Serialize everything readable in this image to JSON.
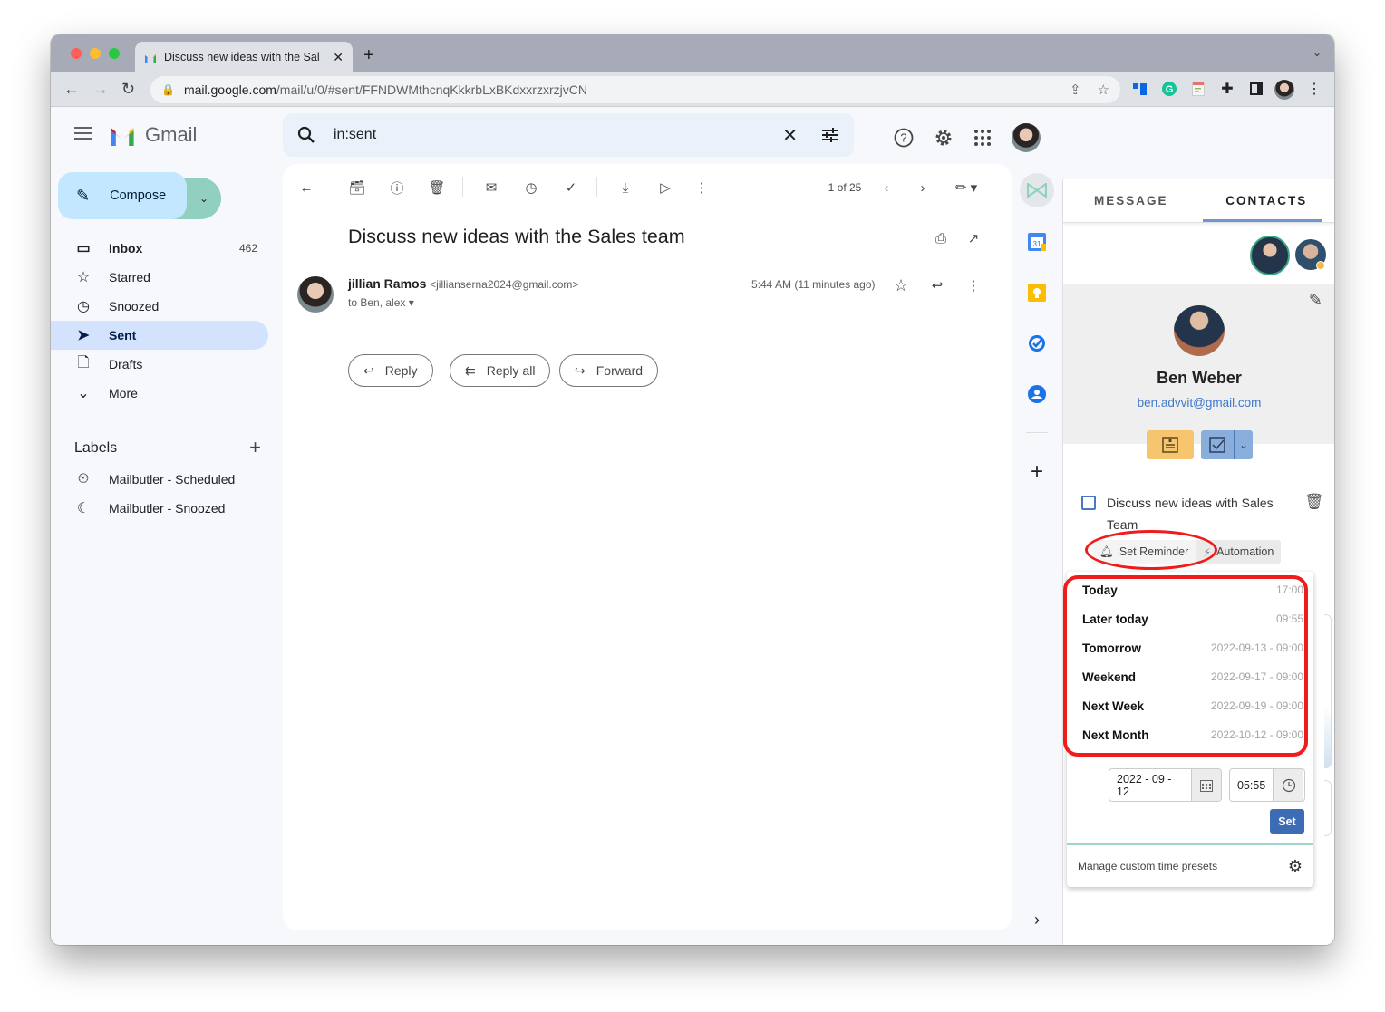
{
  "browser": {
    "tab_title": "Discuss new ideas with the Sal",
    "url_host": "mail.google.com",
    "url_path": "/mail/u/0/#sent/FFNDWMthcnqKkkrbLxBKdxxrzxrzjvCN",
    "colors": {
      "close": "#ff5f57",
      "minimize": "#febc2e",
      "maximize": "#28c840"
    }
  },
  "gmail": {
    "app_name": "Gmail",
    "search_query": "in:sent",
    "compose_label": "Compose",
    "nav": [
      {
        "label": "Inbox",
        "count": "462",
        "icon": "inbox-icon"
      },
      {
        "label": "Starred",
        "count": "",
        "icon": "star-icon"
      },
      {
        "label": "Snoozed",
        "count": "",
        "icon": "clock-icon"
      },
      {
        "label": "Sent",
        "count": "",
        "icon": "send-icon",
        "active": true
      },
      {
        "label": "Drafts",
        "count": "",
        "icon": "draft-icon"
      },
      {
        "label": "More",
        "count": "",
        "icon": "chevron-down-icon"
      }
    ],
    "labels_heading": "Labels",
    "labels": [
      {
        "label": "Mailbutler - Scheduled",
        "icon": "scheduled-icon"
      },
      {
        "label": "Mailbutler - Snoozed",
        "icon": "moon-icon"
      }
    ],
    "toolbar": {
      "pagination": "1 of 25"
    },
    "email": {
      "subject": "Discuss new ideas with the Sales team",
      "sender_name": "jillian Ramos",
      "sender_email": "<jillianserna2024@gmail.com>",
      "recipients": "to Ben, alex",
      "time": "5:44 AM (11 minutes ago)"
    },
    "actions": {
      "reply": "Reply",
      "reply_all": "Reply all",
      "forward": "Forward"
    }
  },
  "mailbutler": {
    "tabs": {
      "message": "MESSAGE",
      "contacts": "CONTACTS"
    },
    "contact": {
      "name": "Ben Weber",
      "email": "ben.advvit@gmail.com"
    },
    "task": {
      "title": "Discuss new ideas with Sales Team"
    },
    "chips": {
      "reminder": "Set Reminder",
      "automation": "Automation"
    },
    "presets": [
      {
        "label": "Today",
        "value": "17:00"
      },
      {
        "label": "Later today",
        "value": "09:55"
      },
      {
        "label": "Tomorrow",
        "value": "2022-09-13 - 09:00"
      },
      {
        "label": "Weekend",
        "value": "2022-09-17 - 09:00"
      },
      {
        "label": "Next Week",
        "value": "2022-09-19 - 09:00"
      },
      {
        "label": "Next Month",
        "value": "2022-10-12 - 09:00"
      }
    ],
    "date_value": "2022 - 09 - 12",
    "time_value": "05:55",
    "set_label": "Set",
    "manage_label": "Manage custom time presets",
    "colors": {
      "highlight": "#ef1c1c",
      "accent": "#3e6cb4",
      "footer": "#a0d6c7"
    }
  }
}
